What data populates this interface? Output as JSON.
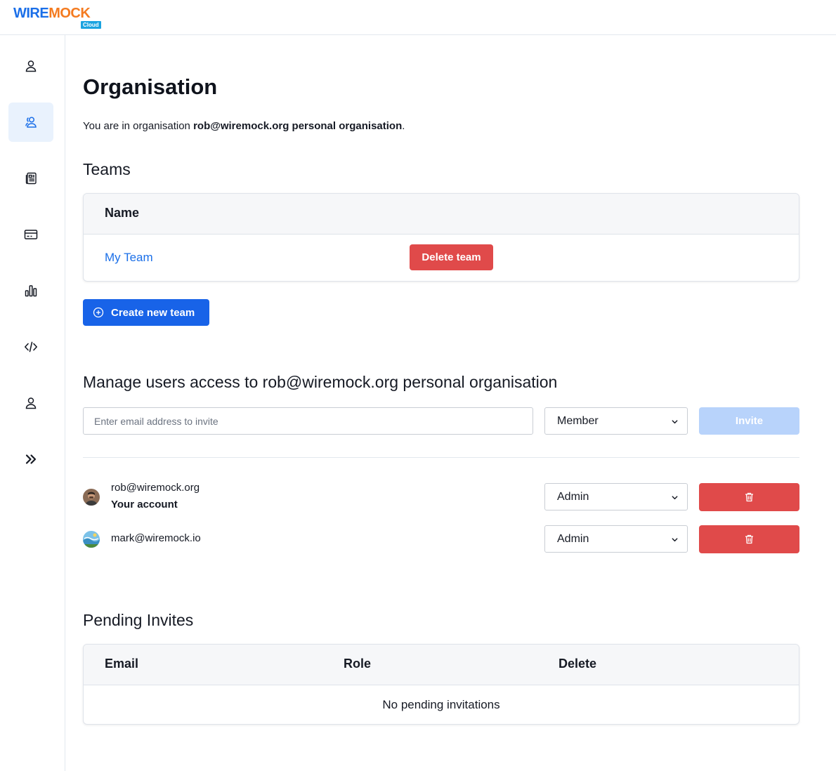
{
  "brand": {
    "word_left": "WIRE",
    "word_right": "MOCK",
    "tag": "Cloud",
    "colors": {
      "wire": "#1b6fe8",
      "mock": "#f47b20",
      "tag_bg": "#1ba3e0"
    }
  },
  "sidebar": {
    "items": [
      {
        "icon": "user-icon",
        "active": false
      },
      {
        "icon": "users-icon",
        "active": true
      },
      {
        "icon": "newspaper-icon",
        "active": false
      },
      {
        "icon": "credit-card-icon",
        "active": false
      },
      {
        "icon": "bar-chart-icon",
        "active": false
      },
      {
        "icon": "code-icon",
        "active": false
      },
      {
        "icon": "account-icon",
        "active": false
      },
      {
        "icon": "expand-icon",
        "active": false
      }
    ]
  },
  "page": {
    "title": "Organisation",
    "intro_prefix": "You are in organisation ",
    "intro_org": "rob@wiremock.org personal organisation",
    "intro_suffix": "."
  },
  "teams": {
    "heading": "Teams",
    "column_name": "Name",
    "rows": [
      {
        "name": "My Team",
        "delete_label": "Delete team"
      }
    ],
    "create_label": "Create new team"
  },
  "access": {
    "heading": "Manage users access to rob@wiremock.org personal organisation",
    "invite_placeholder": "Enter email address to invite",
    "role_value": "Member",
    "invite_label": "Invite",
    "users": [
      {
        "email": "rob@wiremock.org",
        "note": "Your account",
        "role": "Admin"
      },
      {
        "email": "mark@wiremock.io",
        "note": "",
        "role": "Admin"
      }
    ]
  },
  "pending": {
    "heading": "Pending Invites",
    "columns": [
      "Email",
      "Role",
      "Delete"
    ],
    "empty_text": "No pending invitations"
  },
  "colors": {
    "primary": "#1863e8",
    "danger": "#e04a4a",
    "link": "#1b6fe8",
    "invite_disabled": "#b8d3fb",
    "active_nav": "#e9f2fd"
  }
}
